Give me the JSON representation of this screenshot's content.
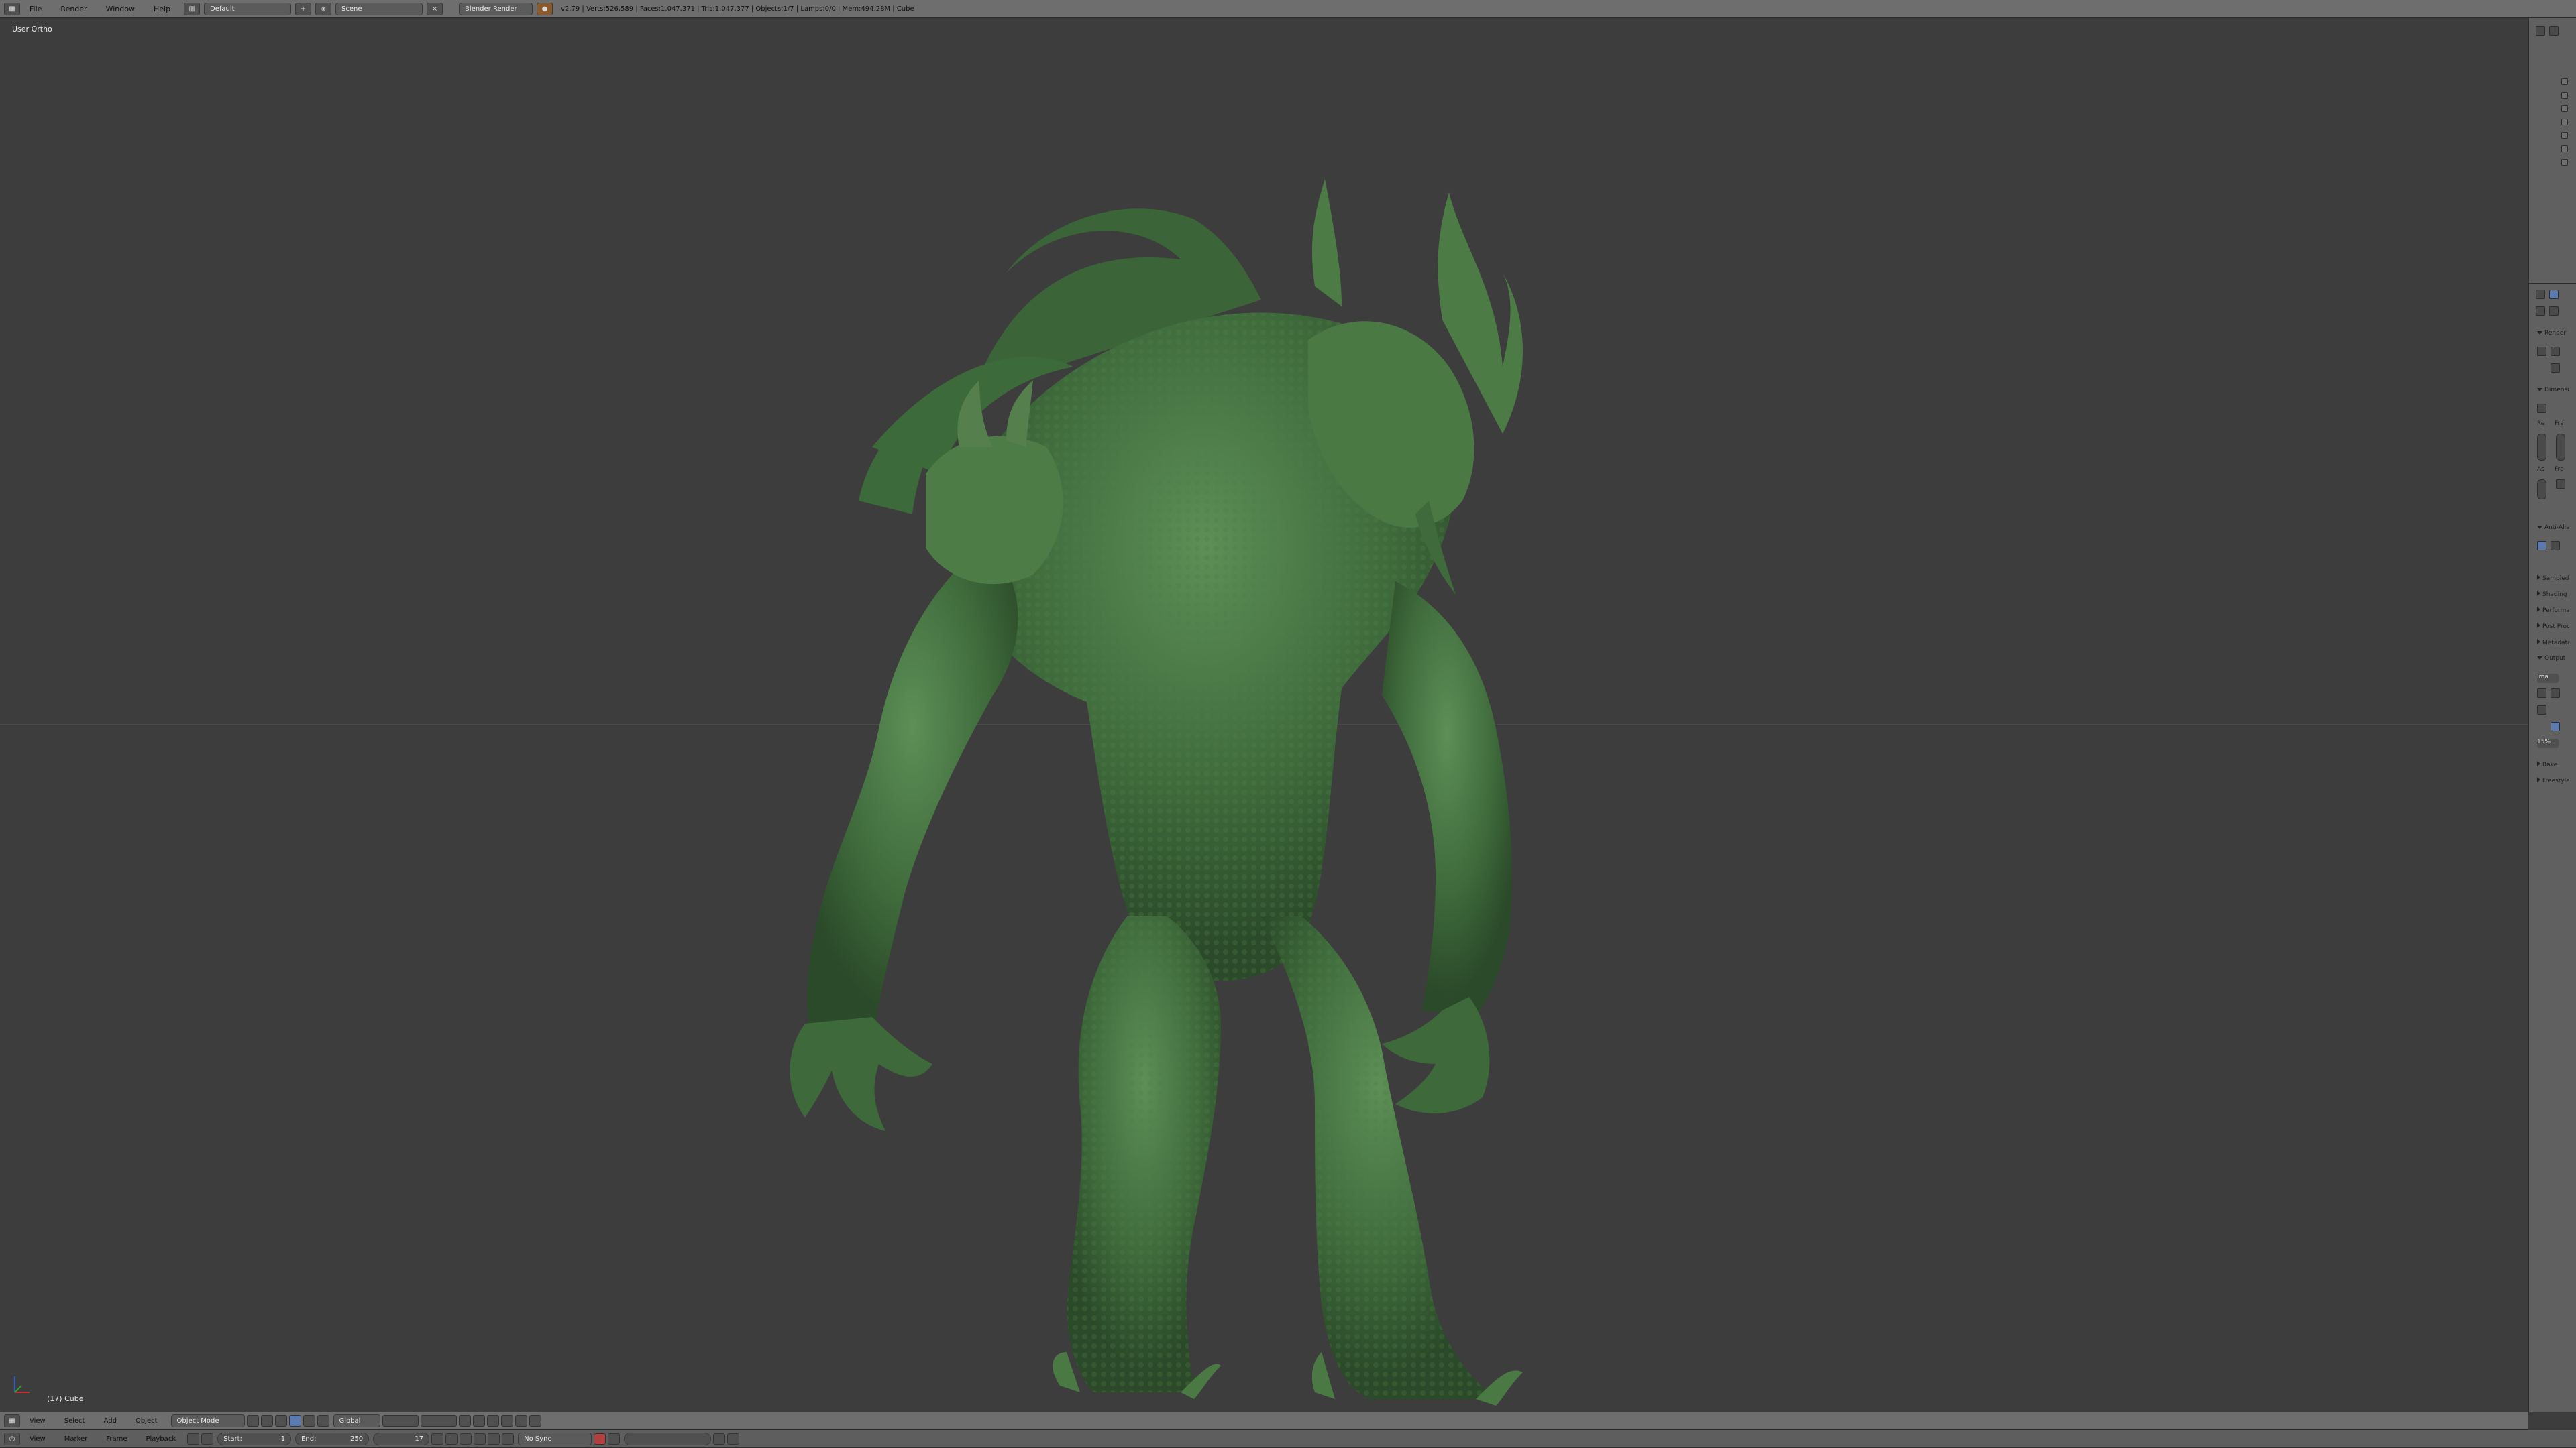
{
  "topbar": {
    "menus": [
      "File",
      "Render",
      "Window",
      "Help"
    ],
    "layout_value": "Default",
    "scene_value": "Scene",
    "engine_value": "Blender Render",
    "stats": "v2.79 | Verts:526,589 | Faces:1,047,371 | Tris:1,047,377 | Objects:1/7 | Lamps:0/0 | Mem:494.28M | Cube"
  },
  "viewport": {
    "view_label": "User Ortho",
    "object_label": "(17) Cube",
    "model_color": "#3f6b3c"
  },
  "right_panel": {
    "sections": [
      {
        "label": "Render",
        "open": true
      },
      {
        "label": "Dimensions",
        "open": true
      },
      {
        "label": "Anti-Aliasing",
        "open": true
      },
      {
        "label": "Sampled Motion Blur",
        "open": false
      },
      {
        "label": "Shading",
        "open": false
      },
      {
        "label": "Performance",
        "open": false
      },
      {
        "label": "Post Processing",
        "open": false
      },
      {
        "label": "Metadata",
        "open": false
      },
      {
        "label": "Output",
        "open": true
      },
      {
        "label": "Bake",
        "open": false
      },
      {
        "label": "Freestyle",
        "open": false
      }
    ],
    "labels": [
      "Re",
      "Fra",
      "As",
      "Fra"
    ],
    "percent_value": "15%",
    "format_value": "Ima"
  },
  "bottombar1": {
    "menus": [
      "View",
      "Select",
      "Add",
      "Object"
    ],
    "mode_value": "Object Mode",
    "orientation_value": "Global"
  },
  "bottombar2": {
    "menus": [
      "View",
      "Marker",
      "Frame",
      "Playback"
    ],
    "start_label": "Start:",
    "start_value": "1",
    "end_label": "End:",
    "end_value": "250",
    "current_frame": "17",
    "sync_value": "No Sync"
  }
}
